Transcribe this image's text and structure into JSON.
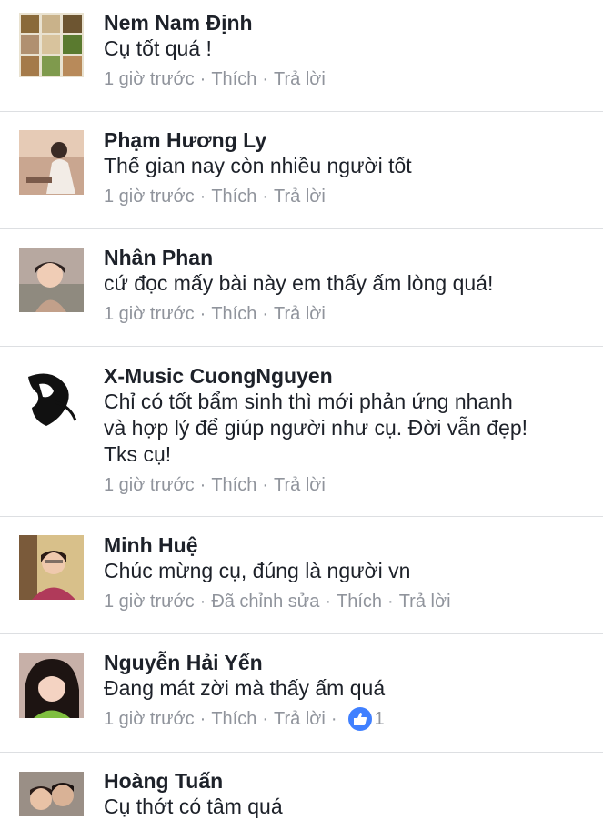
{
  "comments": [
    {
      "name": "Nem Nam Định",
      "text": "Cụ tốt quá !",
      "time": "1 giờ trước",
      "edited": "",
      "like_label": "Thích",
      "reply_label": "Trả lời",
      "reactions": ""
    },
    {
      "name": "Phạm Hương Ly",
      "text": "Thế gian nay còn nhiều người tốt",
      "time": "1 giờ trước",
      "edited": "",
      "like_label": "Thích",
      "reply_label": "Trả lời",
      "reactions": ""
    },
    {
      "name": "Nhân Phan",
      "text": "cứ đọc mấy bài này em thấy ấm lòng quá!",
      "time": "1 giờ trước",
      "edited": "",
      "like_label": "Thích",
      "reply_label": "Trả lời",
      "reactions": ""
    },
    {
      "name": "X-Music CuongNguyen",
      "text": "Chỉ có tốt bẩm sinh thì mới phản ứng nhanh\nvà hợp lý để giúp người như cụ. Đời vẫn đẹp!\nTks cụ!",
      "time": "1 giờ trước",
      "edited": "",
      "like_label": "Thích",
      "reply_label": "Trả lời",
      "reactions": ""
    },
    {
      "name": "Minh Huệ",
      "text": "Chúc mừng cụ, đúng là người vn",
      "time": "1 giờ trước",
      "edited": "Đã chỉnh sửa",
      "like_label": "Thích",
      "reply_label": "Trả lời",
      "reactions": ""
    },
    {
      "name": "Nguyễn Hải Yến",
      "text": "Đang mát zời mà thấy ấm quá",
      "time": "1 giờ trước",
      "edited": "",
      "like_label": "Thích",
      "reply_label": "Trả lời",
      "reactions": "1"
    },
    {
      "name": "Hoàng Tuấn",
      "text": "Cụ thớt có tâm quá",
      "time": "",
      "edited": "",
      "like_label": "",
      "reply_label": "",
      "reactions": ""
    }
  ],
  "colors": {
    "name": "#1d2129",
    "meta": "#90949c",
    "divider": "#dddfe2",
    "like_blue": "#4080ff"
  },
  "icons": {
    "like_reaction": "thumbs-up-icon",
    "separator": "middle-dot"
  }
}
